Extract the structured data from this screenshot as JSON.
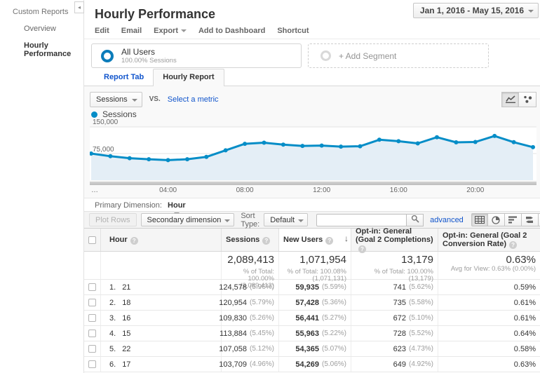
{
  "sidebar": {
    "title": "Custom Reports",
    "items": [
      {
        "label": "Overview",
        "active": false
      },
      {
        "label": "Hourly Performance",
        "active": true
      }
    ]
  },
  "header": {
    "title": "Hourly Performance",
    "date_range": "Jan 1, 2016 - May 15, 2016"
  },
  "actions": [
    {
      "label": "Edit",
      "caret": false
    },
    {
      "label": "Email",
      "caret": false
    },
    {
      "label": "Export",
      "caret": true
    },
    {
      "label": "Add to Dashboard",
      "caret": false
    },
    {
      "label": "Shortcut",
      "caret": false
    }
  ],
  "segments": {
    "all_users": {
      "name": "All Users",
      "detail": "100.00% Sessions"
    },
    "add_segment": "+ Add Segment"
  },
  "tabs": [
    {
      "label": "Report Tab",
      "active": false
    },
    {
      "label": "Hourly Report",
      "active": true
    }
  ],
  "metric_bar": {
    "metric": "Sessions",
    "vs": "VS.",
    "select": "Select a metric"
  },
  "chart_data": {
    "type": "area",
    "title": "Sessions",
    "x": [
      0,
      1,
      2,
      3,
      4,
      5,
      6,
      7,
      8,
      9,
      10,
      11,
      12,
      13,
      14,
      15,
      16,
      17,
      18,
      19,
      20,
      21,
      22,
      23
    ],
    "series": [
      {
        "name": "Sessions",
        "values": [
          75000,
          67500,
          62000,
          59000,
          56500,
          59000,
          65500,
          84000,
          102500,
          105500,
          100000,
          96500,
          97500,
          94500,
          95500,
          113884,
          109830,
          103709,
          120954,
          106500,
          107500,
          124578,
          107058,
          93000
        ]
      }
    ],
    "xticks": [
      {
        "label": "…",
        "index": 0
      },
      {
        "label": "04:00",
        "index": 4
      },
      {
        "label": "08:00",
        "index": 8
      },
      {
        "label": "12:00",
        "index": 12
      },
      {
        "label": "16:00",
        "index": 16
      },
      {
        "label": "20:00",
        "index": 20
      }
    ],
    "yticks": [
      {
        "label": "150,000",
        "value": 150000
      },
      {
        "label": "75,000",
        "value": 75000
      }
    ],
    "ylim": [
      0,
      150000
    ],
    "grid": true,
    "legend_position": "top-left",
    "line_color": "#058dc7",
    "fill_color": "#e4eef6"
  },
  "dimension_bar": {
    "label": "Primary Dimension:",
    "value": "Hour"
  },
  "controls": {
    "plot_rows": "Plot Rows",
    "secondary_dimension": "Secondary dimension",
    "sort_type_label": "Sort Type:",
    "sort_type_value": "Default",
    "search_value": "",
    "advanced": "advanced"
  },
  "table": {
    "columns": [
      "Hour",
      "Sessions",
      "New Users",
      "Opt-in: General (Goal 2 Completions)",
      "Opt-in: General (Goal 2 Conversion Rate)"
    ],
    "sorted_column": "New Users",
    "summary": {
      "sessions": {
        "value": "2,089,413",
        "sub": "% of Total: 100.00% (2,089,413)"
      },
      "new_users": {
        "value": "1,071,954",
        "sub": "% of Total: 100.08% (1,071,131)"
      },
      "completions": {
        "value": "13,179",
        "sub": "% of Total: 100.00% (13,179)"
      },
      "rate": {
        "value": "0.63%",
        "sub": "Avg for View: 0.63% (0.00%)"
      }
    },
    "rows": [
      {
        "rank": "1.",
        "hour": "21",
        "sessions": "124,578",
        "sessions_pct": "(5.96%)",
        "new_users": "59,935",
        "new_users_pct": "(5.59%)",
        "completions": "741",
        "completions_pct": "(5.62%)",
        "rate": "0.59%"
      },
      {
        "rank": "2.",
        "hour": "18",
        "sessions": "120,954",
        "sessions_pct": "(5.79%)",
        "new_users": "57,428",
        "new_users_pct": "(5.36%)",
        "completions": "735",
        "completions_pct": "(5.58%)",
        "rate": "0.61%"
      },
      {
        "rank": "3.",
        "hour": "16",
        "sessions": "109,830",
        "sessions_pct": "(5.26%)",
        "new_users": "56,441",
        "new_users_pct": "(5.27%)",
        "completions": "672",
        "completions_pct": "(5.10%)",
        "rate": "0.61%"
      },
      {
        "rank": "4.",
        "hour": "15",
        "sessions": "113,884",
        "sessions_pct": "(5.45%)",
        "new_users": "55,963",
        "new_users_pct": "(5.22%)",
        "completions": "728",
        "completions_pct": "(5.52%)",
        "rate": "0.64%"
      },
      {
        "rank": "5.",
        "hour": "22",
        "sessions": "107,058",
        "sessions_pct": "(5.12%)",
        "new_users": "54,365",
        "new_users_pct": "(5.07%)",
        "completions": "623",
        "completions_pct": "(4.73%)",
        "rate": "0.58%"
      },
      {
        "rank": "6.",
        "hour": "17",
        "sessions": "103,709",
        "sessions_pct": "(4.96%)",
        "new_users": "54,269",
        "new_users_pct": "(5.06%)",
        "completions": "649",
        "completions_pct": "(4.92%)",
        "rate": "0.63%"
      }
    ]
  }
}
